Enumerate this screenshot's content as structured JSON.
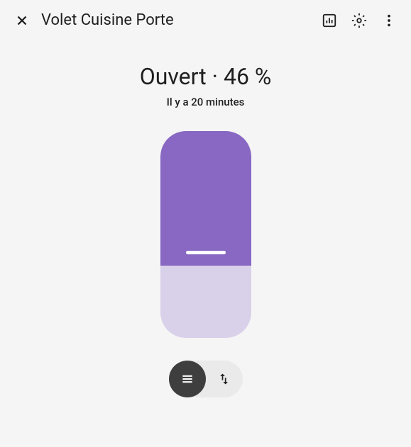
{
  "header": {
    "title": "Volet Cuisine Porte"
  },
  "status": {
    "state": "Ouvert",
    "separator": "·",
    "percent": "46 %"
  },
  "time": "Il y a 20 minutes",
  "shutter": {
    "position_percent": 65
  },
  "colors": {
    "shutter_fill": "#8868c2",
    "shutter_bg": "#d9d0e9"
  }
}
